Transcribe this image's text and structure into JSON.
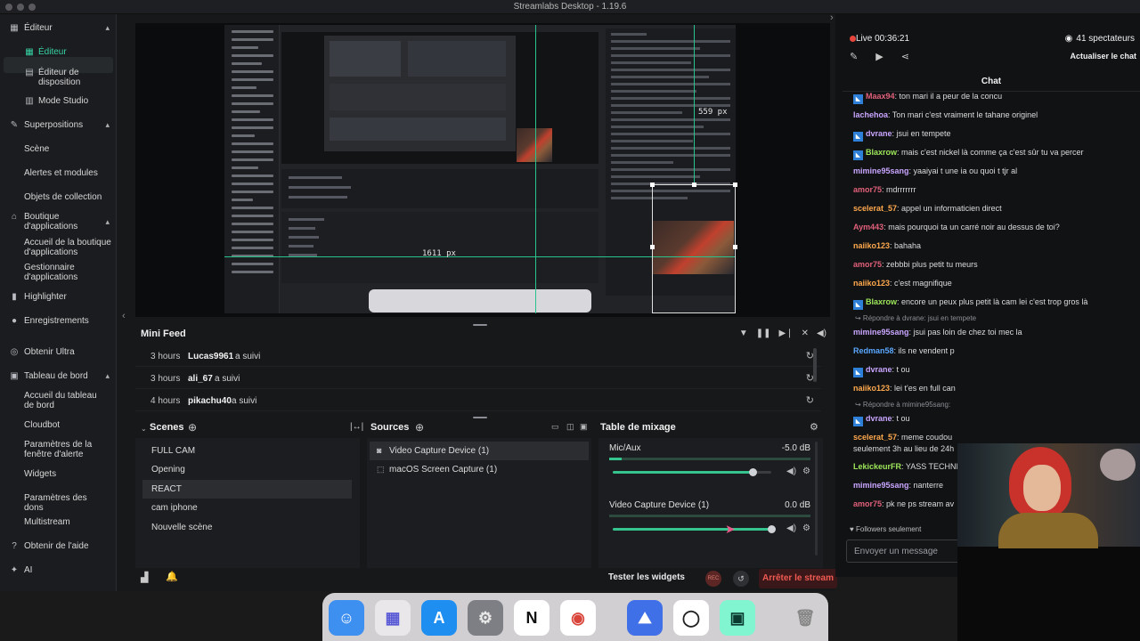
{
  "window": {
    "title": "Streamlabs Desktop - 1.19.6"
  },
  "sidebar": {
    "items": [
      {
        "label": "Éditeur",
        "icon": "grid-icon",
        "chevron": "▴"
      },
      {
        "label": "Éditeur",
        "icon": "editor-icon",
        "active": true
      },
      {
        "label": "Éditeur de disposition",
        "icon": "layout-icon"
      },
      {
        "label": "Mode Studio",
        "icon": "studio-icon"
      },
      {
        "label": "Superpositions",
        "icon": "overlays-icon",
        "chevron": "▴"
      },
      {
        "label": "Scène"
      },
      {
        "label": "Alertes et modules"
      },
      {
        "label": "Objets de collection"
      },
      {
        "label": "Boutique d'applications",
        "icon": "store-icon",
        "chevron": "▴"
      },
      {
        "label": "Accueil de la boutique d'applications"
      },
      {
        "label": "Gestionnaire d'applications"
      },
      {
        "label": "Highlighter",
        "icon": "highlighter-icon"
      },
      {
        "label": "Enregistrements",
        "icon": "recordings-icon"
      },
      {
        "label": "Obtenir Ultra",
        "icon": "ultra-icon"
      },
      {
        "label": "Tableau de bord",
        "icon": "dashboard-icon",
        "chevron": "▴"
      },
      {
        "label": "Accueil du tableau de bord"
      },
      {
        "label": "Cloudbot"
      },
      {
        "label": "Paramètres de la fenêtre d'alerte"
      },
      {
        "label": "Widgets"
      },
      {
        "label": "Paramètres des dons"
      },
      {
        "label": "Multistream"
      },
      {
        "label": "Obtenir de l'aide",
        "icon": "help-icon"
      },
      {
        "label": "AI",
        "icon": "ai-icon"
      }
    ]
  },
  "preview": {
    "width_label": "1611 px",
    "height_label": "559 px"
  },
  "minifeed": {
    "title": "Mini Feed",
    "rows": [
      {
        "time": "3 hours",
        "user": "Lucas9961",
        "action": "a suivi"
      },
      {
        "time": "3 hours",
        "user": "ali_67",
        "action": "a suivi"
      },
      {
        "time": "4 hours",
        "user": "pikachu40",
        "action": "a suivi"
      }
    ]
  },
  "scenes": {
    "title": "Scenes",
    "items": [
      "FULL CAM",
      "Opening",
      "REACT",
      "cam iphone",
      "Nouvelle scène"
    ],
    "selected": 2
  },
  "sources": {
    "title": "Sources",
    "items": [
      {
        "label": "Video Capture Device (1)",
        "icon": "camera-icon"
      },
      {
        "label": "macOS Screen Capture (1)",
        "icon": "screen-icon"
      }
    ],
    "selected": 0
  },
  "mixer": {
    "title": "Table de mixage",
    "channels": [
      {
        "name": "Mic/Aux",
        "db": "-5.0 dB",
        "level": 0.88,
        "meter": 0.06
      },
      {
        "name": "Video Capture Device (1)",
        "db": "0.0 dB",
        "level": 1.0,
        "meter": 0.0
      }
    ]
  },
  "footer": {
    "test_widgets": "Tester les widgets",
    "rec": "REC",
    "stop_stream": "Arrêter le stream"
  },
  "live": {
    "status": "Live 00:36:21",
    "viewers": "41 spectateurs",
    "refresh_chat": "Actualiser le chat"
  },
  "chat": {
    "title": "Chat",
    "messages": [
      {
        "type": "msg",
        "badge": true,
        "user": "Maax94",
        "color": "#e0607a",
        "text": "ton mari il a peur de la concu"
      },
      {
        "type": "msg",
        "user": "lachehoa",
        "color": "#c9a6ff",
        "text": "Ton mari c'est vraiment le tahane originel"
      },
      {
        "type": "msg",
        "badge": true,
        "user": "dvrane",
        "color": "#c9a6ff",
        "text": "jsui en tempete"
      },
      {
        "type": "msg",
        "badge": true,
        "user": "Blaxrow",
        "color": "#9ee75a",
        "text": "mais c'est nickel là comme ça c'est sûr tu va percer"
      },
      {
        "type": "msg",
        "user": "mimine95sang",
        "color": "#c9a6ff",
        "text": "yaaiyai t une ia ou quoi t tjr al"
      },
      {
        "type": "msg",
        "user": "amor75",
        "color": "#e0607a",
        "text": "mdrrrrrrr"
      },
      {
        "type": "msg",
        "user": "scelerat_57",
        "color": "#ffa94d",
        "text": "appel un informaticien direct"
      },
      {
        "type": "msg",
        "user": "Aym443",
        "color": "#e0607a",
        "text": "mais pourquoi ta un carré noir au dessus de toi?"
      },
      {
        "type": "msg",
        "user": "naiiko123",
        "color": "#ffa94d",
        "text": "bahaha"
      },
      {
        "type": "msg",
        "user": "amor75",
        "color": "#e0607a",
        "text": "zebbbi plus petit tu meurs"
      },
      {
        "type": "msg",
        "user": "naiiko123",
        "color": "#ffa94d",
        "text": "c'est magnifique"
      },
      {
        "type": "msg",
        "badge": true,
        "user": "Blaxrow",
        "color": "#9ee75a",
        "text": "encore un peux plus petit là cam lei c'est trop gros là"
      },
      {
        "type": "reply",
        "text": "↪ Répondre à dvrane: jsui en tempete"
      },
      {
        "type": "msg",
        "user": "mimine95sang",
        "color": "#c9a6ff",
        "text": "jsui pas loin de chez toi mec la"
      },
      {
        "type": "msg",
        "user": "Redman58",
        "color": "#5aa8ff",
        "text": "ils ne vendent p"
      },
      {
        "type": "msg",
        "badge": true,
        "user": "dvrane",
        "color": "#c9a6ff",
        "text": "t ou"
      },
      {
        "type": "msg",
        "user": "naiiko123",
        "color": "#ffa94d",
        "text": "lei t'es en full can"
      },
      {
        "type": "reply",
        "text": "↪ Répondre à mimine95sang:"
      },
      {
        "type": "msg",
        "badge": true,
        "user": "dvrane",
        "color": "#c9a6ff",
        "text": "t ou"
      },
      {
        "type": "msg",
        "user": "scelerat_57",
        "color": "#ffa94d",
        "text": "meme coudou"
      },
      {
        "type": "cont",
        "text": "seulement 3h au lieu de 24h"
      },
      {
        "type": "msg",
        "user": "LekickeurFR",
        "color": "#9ee75a",
        "text": "YASS TECHNI"
      },
      {
        "type": "msg",
        "user": "mimine95sang",
        "color": "#c9a6ff",
        "text": "nanterre"
      },
      {
        "type": "msg",
        "user": "amor75",
        "color": "#e0607a",
        "text": "pk ne ps stream av"
      }
    ],
    "followers_only": "Followers seulement",
    "input_placeholder": "Envoyer un message"
  },
  "dock": {
    "apps": [
      {
        "name": "finder-icon",
        "glyph": "☺",
        "bg": "#3d8ff0",
        "fg": "#ffffff"
      },
      {
        "name": "launchpad-icon",
        "glyph": "▦",
        "bg": "#e9e7ea",
        "fg": "#5a5ad6"
      },
      {
        "name": "app-store-icon",
        "glyph": "A",
        "bg": "#1e8ff0",
        "fg": "#ffffff"
      },
      {
        "name": "settings-icon",
        "glyph": "⚙",
        "bg": "#7d7f84",
        "fg": "#e8e8e8"
      },
      {
        "name": "notion-icon",
        "glyph": "N",
        "bg": "#ffffff",
        "fg": "#111111"
      },
      {
        "name": "chrome-icon",
        "glyph": "◉",
        "bg": "#ffffff",
        "fg": "#d9443a"
      },
      {
        "name": "nordvpn-icon",
        "glyph": "⛰",
        "bg": "#4070e8",
        "fg": "#ffffff"
      },
      {
        "name": "obs-icon",
        "glyph": "◯",
        "bg": "#ffffff",
        "fg": "#222222"
      },
      {
        "name": "streamlabs-icon",
        "glyph": "▣",
        "bg": "#80f5d0",
        "fg": "#0b3b30"
      },
      {
        "name": "trash-icon",
        "glyph": "🗑",
        "bg": "transparent",
        "fg": "#888888"
      }
    ]
  }
}
